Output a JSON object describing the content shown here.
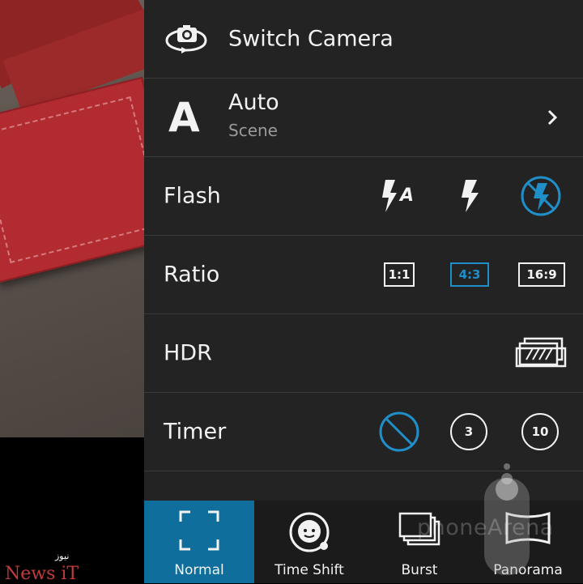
{
  "colors": {
    "accent": "#1f8ec9",
    "panel_bg": "#232323",
    "active_mode_bg": "#0f6e9b"
  },
  "menu": {
    "switch_camera": {
      "label": "Switch Camera",
      "icon": "switch-camera-icon"
    },
    "scene": {
      "label": "Auto",
      "sublabel": "Scene",
      "letter": "A",
      "icon": "chevron-right-icon"
    },
    "flash": {
      "label": "Flash",
      "options": [
        "flash-auto-icon",
        "flash-on-icon",
        "flash-off-icon"
      ],
      "selected": "flash-off-icon",
      "auto_letter": "A"
    },
    "ratio": {
      "label": "Ratio",
      "options": [
        "1:1",
        "4:3",
        "16:9"
      ],
      "selected": "4:3"
    },
    "hdr": {
      "label": "HDR",
      "icon": "hdr-icon"
    },
    "timer": {
      "label": "Timer",
      "options": [
        "off",
        "3",
        "10"
      ],
      "selected": "off"
    }
  },
  "modes": [
    {
      "label": "Normal",
      "icon": "frame-corners-icon",
      "active": true
    },
    {
      "label": "Time Shift",
      "icon": "time-shift-face-icon",
      "active": false
    },
    {
      "label": "Burst",
      "icon": "burst-stack-icon",
      "active": false
    },
    {
      "label": "Panorama",
      "icon": "panorama-icon",
      "active": false
    }
  ],
  "watermark": {
    "text": "phoneArena"
  },
  "logo": {
    "main": "News iT",
    "sub": "نیوز"
  }
}
